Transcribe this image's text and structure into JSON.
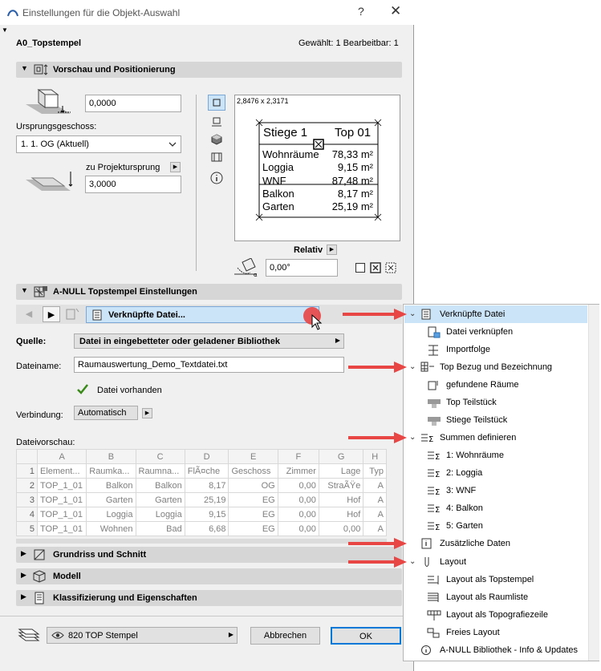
{
  "window": {
    "title": "Einstellungen für die Objekt-Auswahl",
    "help": "?",
    "close": "✕"
  },
  "header": {
    "object_name": "A0_Topstempel",
    "selection_info": "Gewählt: 1 Bearbeitbar: 1"
  },
  "preview_section": {
    "title": "Vorschau und Positionierung",
    "height_value": "0,0000",
    "origin_floor_label": "Ursprungsgeschoss:",
    "origin_floor_value": "1. 1. OG (Aktuell)",
    "project_origin_label": "zu Projekt­ursprung",
    "project_origin_value": "3,0000",
    "preview_dims": "2,8476 x 2,3171",
    "relative_label": "Relativ",
    "angle_value": "0,00°",
    "stamp": {
      "title": "Stiege 1",
      "top": "Top 01",
      "rows": [
        {
          "name": "Wohnräume",
          "value": "78,33 m²"
        },
        {
          "name": "Loggia",
          "value": "9,15 m²"
        },
        {
          "name": "WNF",
          "value": "87,48 m²"
        },
        {
          "name": "Balkon",
          "value": "8,17 m²"
        },
        {
          "name": "Garten",
          "value": "25,19 m²"
        }
      ]
    }
  },
  "settings_section": {
    "title": "A-NULL Topstempel Einstellungen",
    "current_page": "Verknüpfte Datei...",
    "source_label": "Quelle:",
    "source_value": "Datei in eingebetteter oder geladener Bibliothek",
    "filename_label": "Dateiname:",
    "filename_value": "Raumauswertung_Demo_Textdatei.txt",
    "file_status": "Datei vorhanden",
    "connection_label": "Verbindung:",
    "connection_value": "Automatisch",
    "preview_label": "Dateivorschau:",
    "table": {
      "columns": [
        "A",
        "B",
        "C",
        "D",
        "E",
        "F",
        "G",
        "H"
      ],
      "rows": [
        {
          "n": "1",
          "cells": [
            "Element...",
            "Raumka...",
            "Raumna...",
            "FlÃ¤che",
            "Geschoss",
            "Zimmer",
            "Lage",
            "Typ"
          ]
        },
        {
          "n": "2",
          "cells": [
            "TOP_1_01",
            "Balkon",
            "Balkon",
            "8,17",
            "OG",
            "0,00",
            "StraÃŸe",
            "A"
          ]
        },
        {
          "n": "3",
          "cells": [
            "TOP_1_01",
            "Garten",
            "Garten",
            "25,19",
            "EG",
            "0,00",
            "Hof",
            "A"
          ]
        },
        {
          "n": "4",
          "cells": [
            "TOP_1_01",
            "Loggia",
            "Loggia",
            "9,15",
            "EG",
            "0,00",
            "Hof",
            "A"
          ]
        },
        {
          "n": "5",
          "cells": [
            "TOP_1_01",
            "Wohnen",
            "Bad",
            "6,68",
            "EG",
            "0,00",
            "0,00",
            "A"
          ]
        }
      ]
    }
  },
  "collapsed_sections": [
    {
      "title": "Grundriss und Schnitt"
    },
    {
      "title": "Modell"
    },
    {
      "title": "Klassifizierung und Eigenschaften"
    }
  ],
  "footer": {
    "layer_value": "820 TOP Stempel",
    "cancel": "Abbrechen",
    "ok": "OK"
  },
  "menu": {
    "items": [
      {
        "label": "Verknüpfte Datei",
        "level": 0
      },
      {
        "label": "Datei verknüpfen",
        "level": 1
      },
      {
        "label": "Importfolge",
        "level": 1
      },
      {
        "label": "Top Bezug und Bezeichnung",
        "level": 0
      },
      {
        "label": "gefundene Räume",
        "level": 1
      },
      {
        "label": "Top Teilstück",
        "level": 1
      },
      {
        "label": "Stiege Teilstück",
        "level": 1
      },
      {
        "label": "Summen definieren",
        "level": 0
      },
      {
        "label": "1: Wohnräume",
        "level": 1
      },
      {
        "label": "2: Loggia",
        "level": 1
      },
      {
        "label": "3: WNF",
        "level": 1
      },
      {
        "label": "4: Balkon",
        "level": 1
      },
      {
        "label": "5: Garten",
        "level": 1
      },
      {
        "label": "Zusätzliche Daten",
        "level": 0
      },
      {
        "label": "Layout",
        "level": 0
      },
      {
        "label": "Layout als Topstempel",
        "level": 1
      },
      {
        "label": "Layout als Raumliste",
        "level": 1
      },
      {
        "label": "Layout als Topografiezeile",
        "level": 1
      },
      {
        "label": "Freies Layout",
        "level": 1
      },
      {
        "label": "A-NULL Bibliothek - Info & Updates",
        "level": 0
      }
    ]
  },
  "colors": {
    "accent": "#cce4f7",
    "section": "#d6d6d6",
    "arrow": "#e84545",
    "check": "#3a8a1a"
  }
}
